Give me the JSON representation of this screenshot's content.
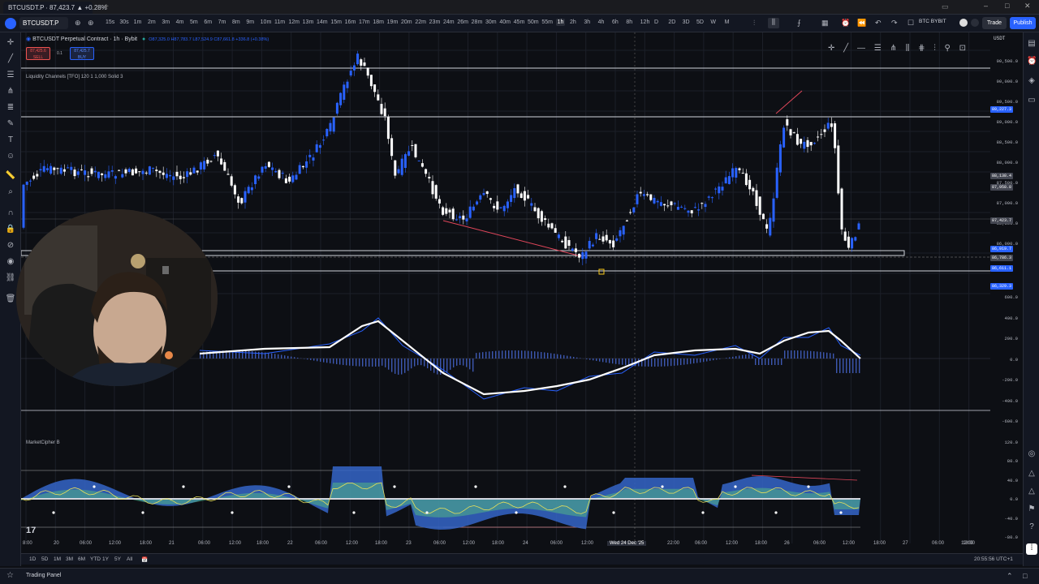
{
  "browser": {
    "active_tab": "BTCUSDT.P ∙ 87,423.7 ▲ +0.28%"
  },
  "toolbar": {
    "symbol": "BTCUSDT.P",
    "timeframes": [
      "15s",
      "30s",
      "1m",
      "2m",
      "3m",
      "4m",
      "5m",
      "6m",
      "7m",
      "8m",
      "9m",
      "10m",
      "11m",
      "12m",
      "13m",
      "14m",
      "15m",
      "16m",
      "17m",
      "18m",
      "19m",
      "20m",
      "22m",
      "23m",
      "24m",
      "26m",
      "28m",
      "30m",
      "40m",
      "45m",
      "50m",
      "55m",
      "1h",
      "2h",
      "3h",
      "4h",
      "6h",
      "8h",
      "12h",
      "D",
      "2D",
      "3D",
      "5D",
      "W",
      "M"
    ],
    "active_timeframe": "1h",
    "broker_label": "BTC BYBIT",
    "trade_label": "Trade",
    "publish_label": "Publish"
  },
  "chart": {
    "legend_title": "BTCUSDT Perpetual Contract · 1h · Bybit",
    "legend_ohlc": "O87,325.0 H87,783.7 L87,524.9 C87,661.8 +336.8 (+0.38%)",
    "sell_price": "87,425.6",
    "sell_label": "SELL",
    "spread": "0.1",
    "buy_price": "87,425.7",
    "buy_label": "BUY",
    "indicator1": "Liquidity Channels [TFO] 120 1 1,000 Solid 3",
    "indicator2": "MarketCipher B",
    "currency": "USDT"
  },
  "price_axis": {
    "labels": [
      "90,500.0",
      "90,000.0",
      "89,500.0",
      "89,000.0",
      "88,500.0",
      "88,000.0",
      "87,500.0",
      "87,000.0",
      "86,500.0",
      "86,000.0"
    ],
    "tags": [
      {
        "text": "89,227.3",
        "color": "#2962ff"
      },
      {
        "text": "88,138.4",
        "color": "#434651"
      },
      {
        "text": "87,958.8",
        "color": "#434651"
      },
      {
        "text": "87,423.7",
        "color": "#434651"
      },
      {
        "text": "86,919.7",
        "color": "#2962ff"
      },
      {
        "text": "86,786.3",
        "color": "#434651"
      },
      {
        "text": "86,611.1",
        "color": "#2962ff"
      },
      {
        "text": "86,329.3",
        "color": "#2962ff"
      }
    ],
    "macd_labels": [
      "600.0",
      "400.0",
      "200.0",
      "0.0",
      "-200.0",
      "-400.0",
      "-600.0"
    ],
    "wt_labels": [
      "120.0",
      "80.0",
      "40.0",
      "0.0",
      "-40.0",
      "-80.0"
    ]
  },
  "time_axis": {
    "labels": [
      "8:00",
      "20",
      "06:00",
      "12:00",
      "18:00",
      "21",
      "06:00",
      "12:00",
      "18:00",
      "22",
      "06:00",
      "12:00",
      "18:00",
      "23",
      "06:00",
      "12:00",
      "18:00",
      "24",
      "06:00",
      "12:00",
      "Wed 24 Dec '25",
      "22:00",
      "06:00",
      "12:00",
      "18:00",
      "26",
      "06:00",
      "12:00",
      "18:00",
      "27",
      "06:00",
      "12:00",
      "18:00"
    ]
  },
  "bottom": {
    "ranges": [
      "1D",
      "5D",
      "1M",
      "3M",
      "6M",
      "YTD",
      "1Y",
      "5Y",
      "All"
    ],
    "clock": "20:55:56 UTC+1"
  },
  "panel": {
    "trading_panel_label": "Trading Panel"
  }
}
